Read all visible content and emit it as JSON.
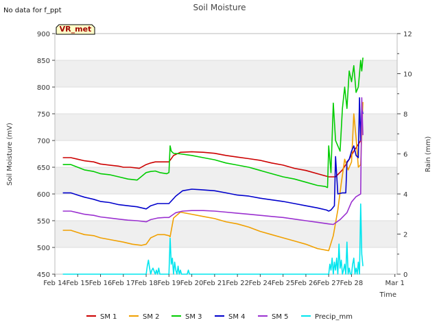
{
  "chart_data": {
    "type": "line",
    "title": "Soil Moisture",
    "note": "No data for f_ppt",
    "badge": "VR_met",
    "xlabel": "Time",
    "ylabel_left": "Soil Moisture (mV)",
    "ylabel_right": "Rain (mm)",
    "ylim_left": [
      450,
      900
    ],
    "ylim_right": [
      0,
      12
    ],
    "xlim": [
      0,
      15
    ],
    "yticks_left": [
      "450",
      "500",
      "550",
      "600",
      "650",
      "700",
      "750",
      "800",
      "850",
      "900"
    ],
    "yticks_right": [
      "0",
      "2",
      "4",
      "6",
      "8",
      "10",
      "12"
    ],
    "xtick_labels": [
      "Feb 14",
      "Feb 15",
      "Feb 16",
      "Feb 17",
      "Feb 18",
      "Feb 19",
      "Feb 20",
      "Feb 21",
      "Feb 22",
      "Feb 24",
      "Feb 25",
      "Feb 26",
      "Feb 27",
      "Feb 28",
      "Mar 1"
    ],
    "xtick_positions": [
      0,
      1,
      2,
      3,
      4,
      5,
      6,
      7,
      8,
      9,
      10,
      11,
      12,
      13,
      14.9
    ],
    "grid": true,
    "legend_position": "bottom",
    "series": [
      {
        "name": "SM 1",
        "color": "#cc0000",
        "axis": "left",
        "x": [
          0.35,
          0.7,
          1.0,
          1.3,
          1.7,
          2.0,
          2.4,
          2.8,
          3.0,
          3.3,
          3.7,
          4.0,
          4.2,
          4.4,
          4.7,
          5.0,
          5.2,
          5.5,
          6.0,
          6.5,
          7.0,
          7.5,
          8.0,
          8.5,
          9.0,
          9.5,
          10.0,
          10.5,
          11.0,
          11.5,
          12.0,
          12.3,
          12.6,
          12.9,
          13.1,
          13.3,
          13.4
        ],
        "y": [
          668,
          668,
          665,
          662,
          660,
          656,
          654,
          652,
          650,
          650,
          648,
          655,
          658,
          660,
          660,
          660,
          672,
          678,
          679,
          678,
          676,
          672,
          669,
          666,
          663,
          658,
          654,
          648,
          644,
          638,
          632,
          632,
          645,
          665,
          680,
          693,
          700
        ]
      },
      {
        "name": "SM 2",
        "color": "#f0a000",
        "axis": "left",
        "x": [
          0.35,
          0.7,
          1.0,
          1.3,
          1.7,
          2.0,
          2.5,
          3.0,
          3.4,
          3.8,
          4.0,
          4.2,
          4.5,
          4.8,
          5.0,
          5.05,
          5.2,
          5.5,
          6.0,
          6.5,
          7.0,
          7.5,
          8.0,
          8.5,
          9.0,
          9.5,
          10.0,
          10.5,
          11.0,
          11.5,
          12.0,
          12.2,
          12.4,
          12.55,
          12.7,
          12.85,
          13.0,
          13.1,
          13.2,
          13.3,
          13.4,
          13.5
        ],
        "y": [
          532,
          532,
          528,
          524,
          522,
          518,
          514,
          510,
          506,
          504,
          506,
          518,
          524,
          524,
          522,
          520,
          555,
          566,
          562,
          558,
          554,
          548,
          544,
          538,
          530,
          524,
          518,
          512,
          506,
          498,
          494,
          522,
          570,
          620,
          665,
          645,
          660,
          750,
          705,
          650,
          655,
          772
        ]
      },
      {
        "name": "SM 3",
        "color": "#00cc00",
        "axis": "left",
        "x": [
          0.35,
          0.7,
          1.0,
          1.3,
          1.7,
          2.0,
          2.4,
          2.8,
          3.2,
          3.6,
          4.0,
          4.2,
          4.4,
          4.6,
          4.9,
          5.0,
          5.05,
          5.1,
          5.2,
          5.5,
          6.0,
          6.5,
          7.0,
          7.5,
          8.0,
          8.5,
          9.0,
          9.5,
          10.0,
          10.5,
          11.0,
          11.5,
          11.85,
          11.95,
          12.0,
          12.1,
          12.2,
          12.3,
          12.4,
          12.5,
          12.6,
          12.7,
          12.8,
          12.9,
          13.0,
          13.1,
          13.2,
          13.3,
          13.4,
          13.45,
          13.5
        ],
        "y": [
          655,
          655,
          650,
          645,
          642,
          638,
          636,
          632,
          628,
          626,
          640,
          642,
          643,
          640,
          638,
          640,
          690,
          680,
          676,
          675,
          672,
          668,
          664,
          658,
          654,
          650,
          644,
          638,
          632,
          628,
          622,
          616,
          614,
          612,
          690,
          640,
          770,
          700,
          690,
          680,
          760,
          800,
          760,
          830,
          810,
          840,
          790,
          800,
          850,
          830,
          855
        ]
      },
      {
        "name": "SM 4",
        "color": "#0000cc",
        "axis": "left",
        "x": [
          0.35,
          0.7,
          1.0,
          1.3,
          1.7,
          2.0,
          2.4,
          2.8,
          3.2,
          3.6,
          4.0,
          4.2,
          4.5,
          4.8,
          5.0,
          5.3,
          5.6,
          6.0,
          6.4,
          7.0,
          7.5,
          8.0,
          8.5,
          9.0,
          9.5,
          10.0,
          10.5,
          11.0,
          11.5,
          11.9,
          12.0,
          12.1,
          12.25,
          12.3,
          12.4,
          12.6,
          12.75,
          12.8,
          12.9,
          13.0,
          13.1,
          13.2,
          13.3,
          13.35,
          13.4,
          13.45,
          13.5
        ],
        "y": [
          602,
          602,
          598,
          594,
          590,
          586,
          584,
          580,
          578,
          576,
          572,
          578,
          582,
          582,
          582,
          596,
          606,
          609,
          608,
          606,
          602,
          598,
          596,
          592,
          589,
          586,
          582,
          578,
          574,
          570,
          568,
          570,
          578,
          670,
          600,
          602,
          602,
          660,
          665,
          680,
          690,
          672,
          668,
          780,
          700,
          760,
          750
        ]
      },
      {
        "name": "SM 5",
        "color": "#9a30d0",
        "axis": "left",
        "x": [
          0.35,
          0.7,
          1.0,
          1.3,
          1.7,
          2.0,
          2.4,
          2.8,
          3.2,
          3.6,
          4.0,
          4.2,
          4.5,
          4.8,
          5.0,
          5.3,
          5.6,
          6.0,
          6.5,
          7.0,
          7.5,
          8.0,
          8.5,
          9.0,
          9.5,
          10.0,
          10.5,
          11.0,
          11.5,
          12.0,
          12.2,
          12.5,
          12.8,
          13.0,
          13.2,
          13.4,
          13.45,
          13.5
        ],
        "y": [
          568,
          568,
          565,
          562,
          560,
          557,
          555,
          553,
          551,
          550,
          548,
          552,
          555,
          556,
          556,
          565,
          568,
          569,
          569,
          568,
          566,
          564,
          562,
          560,
          558,
          556,
          553,
          550,
          547,
          544,
          543,
          552,
          565,
          585,
          595,
          600,
          780,
          710
        ]
      },
      {
        "name": "Precip_mm",
        "color": "#00e5ee",
        "axis": "right",
        "x": [
          0.35,
          4.0,
          4.05,
          4.1,
          4.15,
          4.2,
          4.25,
          4.3,
          4.4,
          4.45,
          4.5,
          4.55,
          4.6,
          5.0,
          5.05,
          5.1,
          5.15,
          5.2,
          5.25,
          5.3,
          5.35,
          5.4,
          5.45,
          5.5,
          5.55,
          5.6,
          5.8,
          5.85,
          5.9,
          12.0,
          12.05,
          12.1,
          12.15,
          12.2,
          12.25,
          12.3,
          12.35,
          12.4,
          12.45,
          12.5,
          12.55,
          12.6,
          12.65,
          12.7,
          12.75,
          12.8,
          12.85,
          12.9,
          12.95,
          13.0,
          13.05,
          13.1,
          13.15,
          13.2,
          13.25,
          13.3,
          13.35,
          13.4,
          13.45,
          13.5
        ],
        "y": [
          0,
          0,
          0.4,
          0.7,
          0.3,
          0,
          0.2,
          0.3,
          0,
          0.2,
          0,
          0.3,
          0,
          0,
          1.8,
          0.5,
          0.8,
          0,
          0.6,
          0.2,
          0,
          0.4,
          0,
          0.2,
          0,
          0,
          0,
          0.2,
          0,
          0,
          0.5,
          0.2,
          0.8,
          0,
          0.6,
          0.2,
          0.8,
          0,
          1.5,
          0.3,
          0.7,
          0,
          0.2,
          0.5,
          0,
          1.6,
          0,
          0.3,
          0,
          0,
          0.5,
          0.8,
          0,
          0.3,
          0,
          0.6,
          0,
          3.5,
          1.0,
          0.4
        ]
      }
    ]
  }
}
